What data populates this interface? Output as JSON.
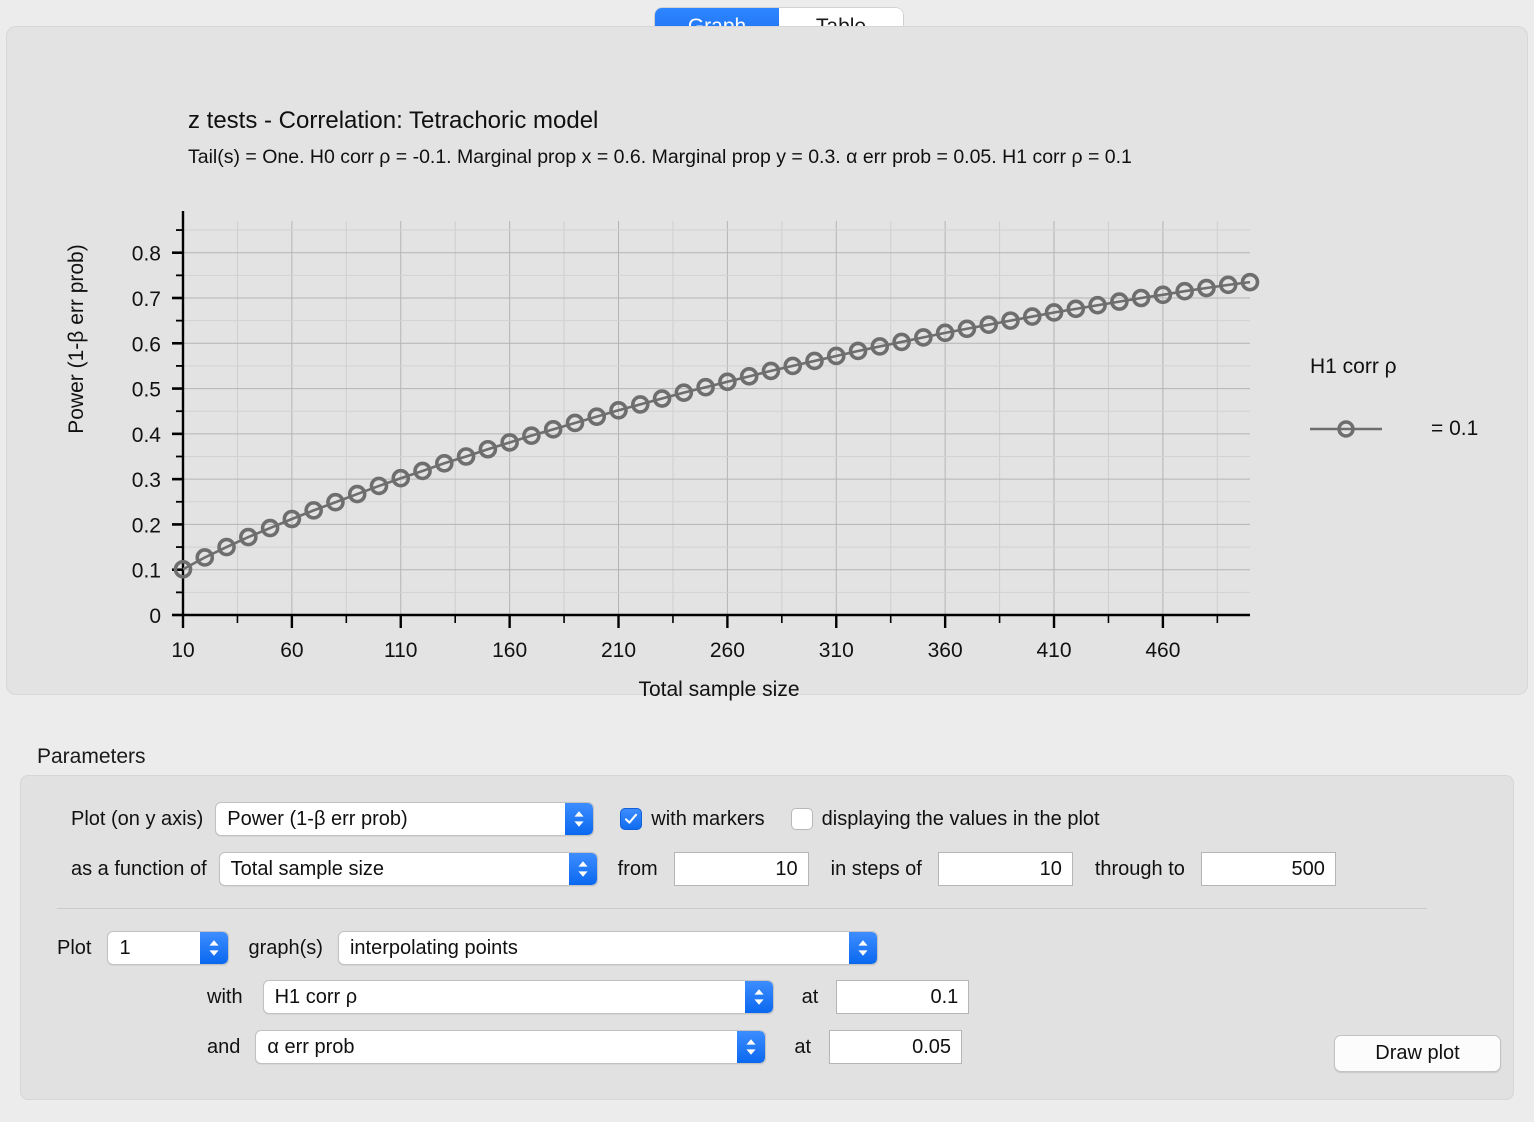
{
  "tabs": [
    {
      "label": "Graph",
      "active": true
    },
    {
      "label": "Table",
      "active": false
    }
  ],
  "chart_data": {
    "type": "line",
    "title": "z tests - Correlation: Tetrachoric model",
    "subtitle": "Tail(s) = One. H0 corr ρ = -0.1. Marginal prop x = 0.6. Marginal prop y = 0.3. α err prob = 0.05. H1 corr ρ = 0.1",
    "xlabel": "Total sample size",
    "ylabel": "Power (1-β err prob)",
    "xlim": [
      10,
      500
    ],
    "ylim": [
      0,
      0.87
    ],
    "x_ticklabels": [
      "10",
      "60",
      "110",
      "160",
      "210",
      "260",
      "310",
      "360",
      "410",
      "460"
    ],
    "x_tickvalues": [
      10,
      60,
      110,
      160,
      210,
      260,
      310,
      360,
      410,
      460
    ],
    "y_ticklabels": [
      "0",
      "0.1",
      "0.2",
      "0.3",
      "0.4",
      "0.5",
      "0.6",
      "0.7",
      "0.8"
    ],
    "y_tickvalues": [
      0,
      0.1,
      0.2,
      0.3,
      0.4,
      0.5,
      0.6,
      0.7,
      0.8
    ],
    "x_minor_step": 25,
    "y_minor_step": 0.05,
    "grid": true,
    "markers": true,
    "legend_position": "right",
    "legend_title": "H1 corr ρ",
    "series": [
      {
        "name": "= 0.1",
        "color": "#6e6e6e",
        "x": [
          10,
          20,
          30,
          40,
          50,
          60,
          70,
          80,
          90,
          100,
          110,
          120,
          130,
          140,
          150,
          160,
          170,
          180,
          190,
          200,
          210,
          220,
          230,
          240,
          250,
          260,
          270,
          280,
          290,
          300,
          310,
          320,
          330,
          340,
          350,
          360,
          370,
          380,
          390,
          400,
          410,
          420,
          430,
          440,
          450,
          460,
          470,
          480,
          490,
          500
        ],
        "values": [
          0.101,
          0.127,
          0.15,
          0.172,
          0.192,
          0.212,
          0.231,
          0.249,
          0.267,
          0.285,
          0.302,
          0.318,
          0.335,
          0.35,
          0.366,
          0.381,
          0.396,
          0.41,
          0.424,
          0.438,
          0.452,
          0.465,
          0.478,
          0.491,
          0.503,
          0.515,
          0.527,
          0.539,
          0.55,
          0.561,
          0.572,
          0.583,
          0.593,
          0.603,
          0.613,
          0.623,
          0.632,
          0.641,
          0.65,
          0.659,
          0.668,
          0.676,
          0.684,
          0.692,
          0.7,
          0.707,
          0.715,
          0.722,
          0.729,
          0.735
        ]
      }
    ]
  },
  "parameters": {
    "heading": "Parameters",
    "plot_y_label": "Plot (on y axis)",
    "plot_y_value": "Power (1-β err prob)",
    "with_markers_label": "with markers",
    "with_markers_checked": true,
    "display_values_label": "displaying the values in the plot",
    "display_values_checked": false,
    "as_function_label": "as a function of",
    "as_function_value": "Total sample size",
    "from_label": "from",
    "from_value": "10",
    "steps_label": "in steps of",
    "steps_value": "10",
    "through_label": "through to",
    "through_value": "500",
    "plot_label": "Plot",
    "plot_count": "1",
    "graphs_label": "graph(s)",
    "graph_style_value": "interpolating points",
    "with_label": "with",
    "with_value": "H1 corr ρ",
    "with_at_label": "at",
    "with_at_value": "0.1",
    "and_label": "and",
    "and_value": "α err prob",
    "and_at_label": "at",
    "and_at_value": "0.05",
    "draw_plot_label": "Draw plot"
  },
  "colors": {
    "accent": "#1a6ef0",
    "curve": "#6e6e6e",
    "panel": "#e1e1e1",
    "window": "#ececec"
  }
}
